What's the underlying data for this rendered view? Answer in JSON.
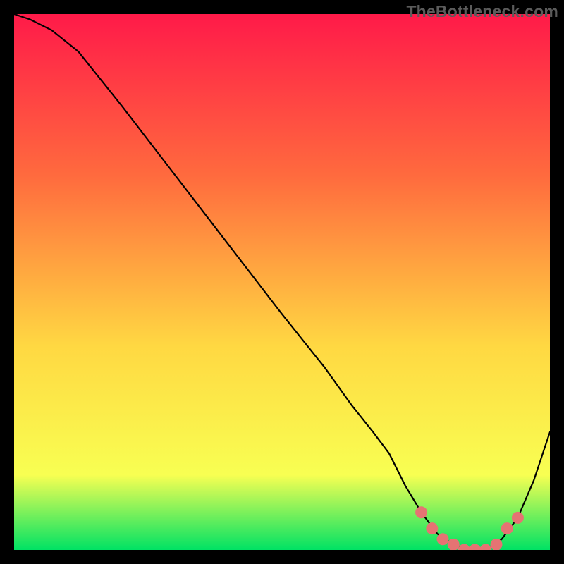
{
  "watermark": "TheBottleneck.com",
  "colors": {
    "frame": "#000000",
    "grad_top": "#ff1a49",
    "grad_mid1": "#ff6a3e",
    "grad_mid2": "#ffd842",
    "grad_mid3": "#f8ff52",
    "grad_bottom": "#00e264",
    "curve": "#000000",
    "marker": "#e57373"
  },
  "chart_data": {
    "type": "line",
    "title": "",
    "xlabel": "",
    "ylabel": "",
    "xlim": [
      0,
      100
    ],
    "ylim": [
      0,
      100
    ],
    "legend": false,
    "grid": false,
    "series": [
      {
        "name": "bottleneck-curve",
        "x": [
          0,
          3,
          7,
          12,
          20,
          30,
          40,
          50,
          58,
          63,
          67,
          70,
          73,
          76,
          79,
          82,
          85,
          88,
          91,
          94,
          97,
          100
        ],
        "y": [
          100,
          99,
          97,
          93,
          83,
          70,
          57,
          44,
          34,
          27,
          22,
          18,
          12,
          7,
          3,
          1,
          0,
          0,
          2,
          6,
          13,
          22
        ]
      }
    ],
    "markers": {
      "name": "low-bottleneck-region",
      "x": [
        76,
        78,
        80,
        82,
        84,
        86,
        88,
        90,
        92,
        94
      ],
      "y": [
        7,
        4,
        2,
        1,
        0,
        0,
        0,
        1,
        4,
        6
      ]
    }
  }
}
